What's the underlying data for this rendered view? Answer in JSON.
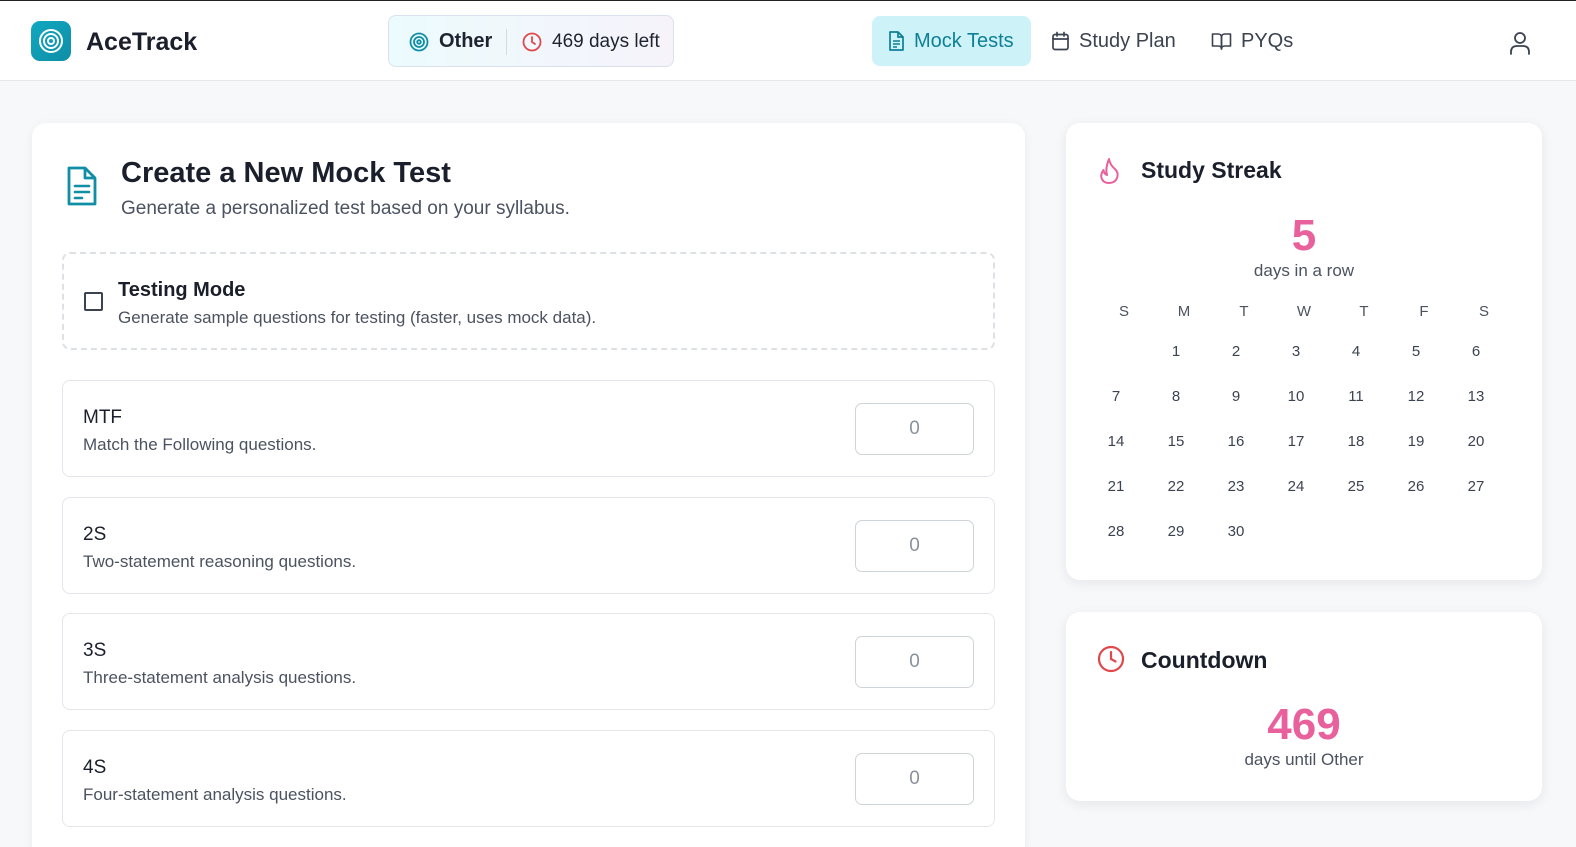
{
  "app": {
    "name": "AceTrack"
  },
  "header": {
    "exam_name": "Other",
    "days_left": "469 days left",
    "nav": [
      {
        "label": "Mock Tests",
        "icon": "document-icon",
        "active": true
      },
      {
        "label": "Study Plan",
        "icon": "calendar-icon",
        "active": false
      },
      {
        "label": "PYQs",
        "icon": "book-icon",
        "active": false
      }
    ],
    "accent": "#0f7f96",
    "active_bg": "#cdf3f8"
  },
  "mock_test": {
    "title": "Create a New Mock Test",
    "subtitle": "Generate a personalized test based on your syllabus.",
    "testing_mode": {
      "title": "Testing Mode",
      "description": "Generate sample questions for testing (faster, uses mock data).",
      "checked": false
    },
    "question_types": [
      {
        "code": "MTF",
        "description": "Match the Following questions.",
        "placeholder": "0"
      },
      {
        "code": "2S",
        "description": "Two-statement reasoning questions.",
        "placeholder": "0"
      },
      {
        "code": "3S",
        "description": "Three-statement analysis questions.",
        "placeholder": "0"
      },
      {
        "code": "4S",
        "description": "Four-statement analysis questions.",
        "placeholder": "0"
      }
    ]
  },
  "streak": {
    "title": "Study Streak",
    "count": "5",
    "caption": "days in a row",
    "weekdays": [
      "S",
      "M",
      "T",
      "W",
      "T",
      "F",
      "S"
    ],
    "days": [
      "1",
      "2",
      "3",
      "4",
      "5",
      "6",
      "7",
      "8",
      "9",
      "10",
      "11",
      "12",
      "13",
      "14",
      "15",
      "16",
      "17",
      "18",
      "19",
      "20",
      "21",
      "22",
      "23",
      "24",
      "25",
      "26",
      "27",
      "28",
      "29",
      "30"
    ],
    "highlight_color": "#e8609c"
  },
  "countdown": {
    "title": "Countdown",
    "count": "469",
    "caption": "days until Other",
    "icon_color": "#e0484a"
  }
}
